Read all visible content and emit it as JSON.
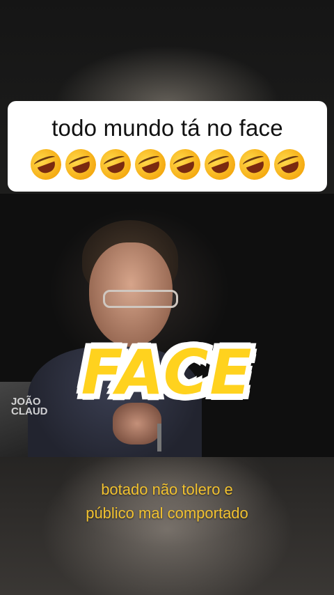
{
  "caption": {
    "text": "todo mundo tá no face",
    "emoji_count": 8,
    "emoji_icon": "rolling-on-floor-laughing-icon"
  },
  "video": {
    "lower_third_line1": "JOÃO",
    "lower_third_line2": "CLAUD"
  },
  "overlay": {
    "big_word": "FACE",
    "big_word_color": "#ffd21e"
  },
  "subtitle": {
    "line1": "botado não tolero e",
    "line2": "público mal comportado",
    "color": "#f2c230"
  }
}
